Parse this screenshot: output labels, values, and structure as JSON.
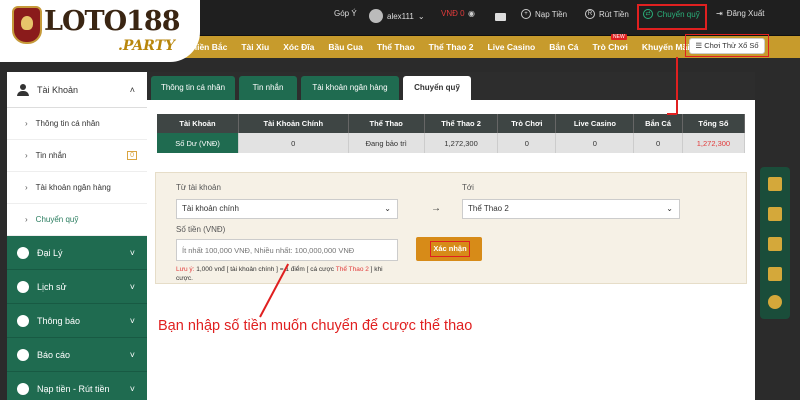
{
  "logo": {
    "text": "LOTO188",
    "sub": ".PARTY"
  },
  "topbar": {
    "feedback": "Góp Ý",
    "username": "alex111",
    "balance": "VNĐ 0",
    "deposit": "Nạp Tiền",
    "withdraw": "Rút Tiền",
    "transfer": "Chuyển quỹ",
    "logout": "Đăng Xuất"
  },
  "nav": {
    "items": [
      "Miền Bắc",
      "Tài Xỉu",
      "Xóc Đĩa",
      "Bầu Cua",
      "Thể Thao",
      "Thể Thao 2",
      "Live Casino",
      "Bắn Cá",
      "Trò Chơi",
      "Khuyến Mãi"
    ],
    "new_badge": "NEW",
    "try_button": "Chơi Thử Xổ Số"
  },
  "sidebar": {
    "account": "Tài Khoản",
    "sub_items": [
      "Thông tin cá nhân",
      "Tin nhắn",
      "Tài khoản ngân hàng",
      "Chuyển quỹ"
    ],
    "message_count": "0",
    "main_items": [
      "Đại Lý",
      "Lịch sử",
      "Thông báo",
      "Báo cáo",
      "Nạp tiền - Rút tiền"
    ]
  },
  "tabs": [
    "Thông tin cá nhân",
    "Tin nhắn",
    "Tài khoản ngân hàng",
    "Chuyển quỹ"
  ],
  "table": {
    "headers": [
      "Tài Khoản",
      "Tài Khoản Chính",
      "Thể Thao",
      "Thể Thao 2",
      "Trò Chơi",
      "Live Casino",
      "Bắn Cá",
      "Tổng Số"
    ],
    "row": [
      "Số Dư (VNĐ)",
      "0",
      "Đang bảo trì",
      "1,272,300",
      "0",
      "0",
      "0",
      "1,272,300"
    ]
  },
  "form": {
    "from_label": "Từ tài khoản",
    "from_value": "Tài khoản chính",
    "to_label": "Tới",
    "to_value": "Thể Thao 2",
    "amount_label": "Số tiền (VNĐ)",
    "amount_placeholder": "Ít nhất 100,000 VNĐ, Nhiều nhất: 100,000,000 VNĐ",
    "submit": "Xác nhận",
    "note_prefix": "Lưu ý: ",
    "note_text": "1,000 vnđ [ tài khoản chính ] = 1 điểm [ cá cược ",
    "note_red": "Thể Thao 2",
    "note_suffix": " ] khi cược."
  },
  "annotation": "Bạn nhập số tiền muốn chuyển để cược thể thao",
  "colors": {
    "green": "#1f6b50",
    "gold": "#c79b2c",
    "red": "#e02020"
  }
}
